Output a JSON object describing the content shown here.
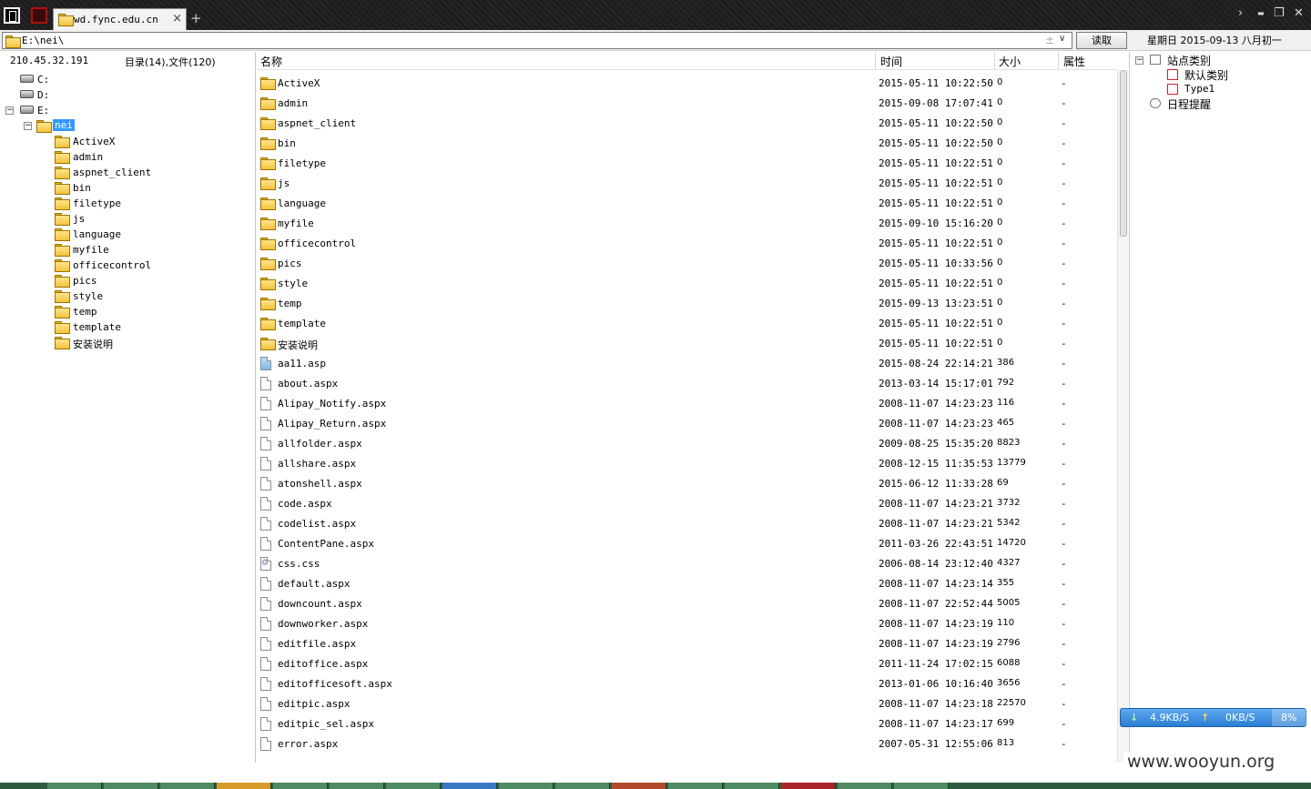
{
  "titlebar": {
    "tab_label": "wd.fync.edu.cn",
    "tab_close": "×",
    "tab_add": "+",
    "controls": {
      "chevron": "›",
      "minimize": "▬",
      "restore": "❐",
      "close": "✕"
    }
  },
  "addressbar": {
    "path": "E:\\nei\\",
    "plus": "±",
    "dropdown": "∨",
    "read_button": "读取",
    "date": "星期日 2015-09-13 八月初一"
  },
  "left": {
    "ip": "210.45.32.191",
    "counts": "目录(14),文件(120)",
    "drives": [
      {
        "label": "C:"
      },
      {
        "label": "D:"
      },
      {
        "label": "E:"
      }
    ],
    "expanders": {
      "collapse": "−"
    },
    "selected_folder": "nei",
    "folders": [
      "ActiveX",
      "admin",
      "aspnet_client",
      "bin",
      "filetype",
      "js",
      "language",
      "myfile",
      "officecontrol",
      "pics",
      "style",
      "temp",
      "template",
      "安装说明"
    ]
  },
  "list": {
    "columns": {
      "name": "名称",
      "time": "时间",
      "size": "大小",
      "attr": "属性"
    },
    "rows": [
      {
        "name": "ActiveX",
        "time": "2015-05-11 10:22:50",
        "size": "0",
        "attr": "-",
        "icon": "folder-icon"
      },
      {
        "name": "admin",
        "time": "2015-09-08 17:07:41",
        "size": "0",
        "attr": "-",
        "icon": "folder-icon"
      },
      {
        "name": "aspnet_client",
        "time": "2015-05-11 10:22:50",
        "size": "0",
        "attr": "-",
        "icon": "folder-icon"
      },
      {
        "name": "bin",
        "time": "2015-05-11 10:22:50",
        "size": "0",
        "attr": "-",
        "icon": "folder-icon"
      },
      {
        "name": "filetype",
        "time": "2015-05-11 10:22:51",
        "size": "0",
        "attr": "-",
        "icon": "folder-icon"
      },
      {
        "name": "js",
        "time": "2015-05-11 10:22:51",
        "size": "0",
        "attr": "-",
        "icon": "folder-icon"
      },
      {
        "name": "language",
        "time": "2015-05-11 10:22:51",
        "size": "0",
        "attr": "-",
        "icon": "folder-icon"
      },
      {
        "name": "myfile",
        "time": "2015-09-10 15:16:20",
        "size": "0",
        "attr": "-",
        "icon": "folder-icon"
      },
      {
        "name": "officecontrol",
        "time": "2015-05-11 10:22:51",
        "size": "0",
        "attr": "-",
        "icon": "folder-icon"
      },
      {
        "name": "pics",
        "time": "2015-05-11 10:33:56",
        "size": "0",
        "attr": "-",
        "icon": "folder-icon"
      },
      {
        "name": "style",
        "time": "2015-05-11 10:22:51",
        "size": "0",
        "attr": "-",
        "icon": "folder-icon"
      },
      {
        "name": "temp",
        "time": "2015-09-13 13:23:51",
        "size": "0",
        "attr": "-",
        "icon": "folder-icon"
      },
      {
        "name": "template",
        "time": "2015-05-11 10:22:51",
        "size": "0",
        "attr": "-",
        "icon": "folder-icon"
      },
      {
        "name": "安装说明",
        "time": "2015-05-11 10:22:51",
        "size": "0",
        "attr": "-",
        "icon": "folder-icon"
      },
      {
        "name": "aa11.asp",
        "time": "2015-08-24 22:14:21",
        "size": "386",
        "attr": "-",
        "icon": "asp-file-icon"
      },
      {
        "name": "about.aspx",
        "time": "2013-03-14 15:17:01",
        "size": "792",
        "attr": "-",
        "icon": "file-icon"
      },
      {
        "name": "Alipay_Notify.aspx",
        "time": "2008-11-07 14:23:23",
        "size": "116",
        "attr": "-",
        "icon": "file-icon"
      },
      {
        "name": "Alipay_Return.aspx",
        "time": "2008-11-07 14:23:23",
        "size": "465",
        "attr": "-",
        "icon": "file-icon"
      },
      {
        "name": "allfolder.aspx",
        "time": "2009-08-25 15:35:20",
        "size": "8823",
        "attr": "-",
        "icon": "file-icon"
      },
      {
        "name": "allshare.aspx",
        "time": "2008-12-15 11:35:53",
        "size": "13779",
        "attr": "-",
        "icon": "file-icon"
      },
      {
        "name": "atonshell.aspx",
        "time": "2015-06-12 11:33:28",
        "size": "69",
        "attr": "-",
        "icon": "file-icon"
      },
      {
        "name": "code.aspx",
        "time": "2008-11-07 14:23:21",
        "size": "3732",
        "attr": "-",
        "icon": "file-icon"
      },
      {
        "name": "codelist.aspx",
        "time": "2008-11-07 14:23:21",
        "size": "5342",
        "attr": "-",
        "icon": "file-icon"
      },
      {
        "name": "ContentPane.aspx",
        "time": "2011-03-26 22:43:51",
        "size": "14720",
        "attr": "-",
        "icon": "file-icon"
      },
      {
        "name": "css.css",
        "time": "2006-08-14 23:12:40",
        "size": "4327",
        "attr": "-",
        "icon": "css-file-icon"
      },
      {
        "name": "default.aspx",
        "time": "2008-11-07 14:23:14",
        "size": "355",
        "attr": "-",
        "icon": "file-icon"
      },
      {
        "name": "downcount.aspx",
        "time": "2008-11-07 22:52:44",
        "size": "5005",
        "attr": "-",
        "icon": "file-icon"
      },
      {
        "name": "downworker.aspx",
        "time": "2008-11-07 14:23:19",
        "size": "110",
        "attr": "-",
        "icon": "file-icon"
      },
      {
        "name": "editfile.aspx",
        "time": "2008-11-07 14:23:19",
        "size": "2796",
        "attr": "-",
        "icon": "file-icon"
      },
      {
        "name": "editoffice.aspx",
        "time": "2011-11-24 17:02:15",
        "size": "6088",
        "attr": "-",
        "icon": "file-icon"
      },
      {
        "name": "editofficesoft.aspx",
        "time": "2013-01-06 10:16:40",
        "size": "3656",
        "attr": "-",
        "icon": "file-icon"
      },
      {
        "name": "editpic.aspx",
        "time": "2008-11-07 14:23:18",
        "size": "22570",
        "attr": "-",
        "icon": "file-icon"
      },
      {
        "name": "editpic_sel.aspx",
        "time": "2008-11-07 14:23:17",
        "size": "699",
        "attr": "-",
        "icon": "file-icon"
      },
      {
        "name": "error.aspx",
        "time": "2007-05-31 12:55:06",
        "size": "813",
        "attr": "-",
        "icon": "file-icon"
      }
    ]
  },
  "right": {
    "site_category": "站点类别",
    "default_category": "默认类别",
    "type1": "Type1",
    "schedule": "日程提醒",
    "collapse": "−"
  },
  "network": {
    "down_arrow": "↓",
    "down_speed": "4.9KB/S",
    "up_arrow": "↑",
    "up_speed": "0KB/S",
    "percent": "8%"
  },
  "watermark": "www.wooyun.org"
}
